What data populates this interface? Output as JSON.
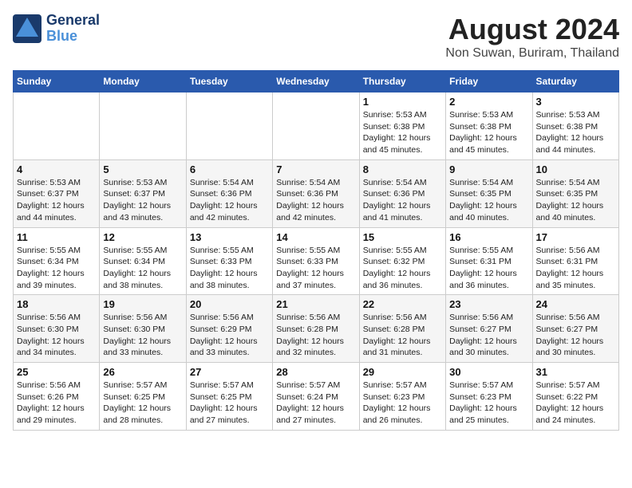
{
  "header": {
    "logo_general": "General",
    "logo_blue": "Blue",
    "month": "August 2024",
    "location": "Non Suwan, Buriram, Thailand"
  },
  "weekdays": [
    "Sunday",
    "Monday",
    "Tuesday",
    "Wednesday",
    "Thursday",
    "Friday",
    "Saturday"
  ],
  "rows": [
    [
      {
        "day": "",
        "info": ""
      },
      {
        "day": "",
        "info": ""
      },
      {
        "day": "",
        "info": ""
      },
      {
        "day": "",
        "info": ""
      },
      {
        "day": "1",
        "info": "Sunrise: 5:53 AM\nSunset: 6:38 PM\nDaylight: 12 hours\nand 45 minutes."
      },
      {
        "day": "2",
        "info": "Sunrise: 5:53 AM\nSunset: 6:38 PM\nDaylight: 12 hours\nand 45 minutes."
      },
      {
        "day": "3",
        "info": "Sunrise: 5:53 AM\nSunset: 6:38 PM\nDaylight: 12 hours\nand 44 minutes."
      }
    ],
    [
      {
        "day": "4",
        "info": "Sunrise: 5:53 AM\nSunset: 6:37 PM\nDaylight: 12 hours\nand 44 minutes."
      },
      {
        "day": "5",
        "info": "Sunrise: 5:53 AM\nSunset: 6:37 PM\nDaylight: 12 hours\nand 43 minutes."
      },
      {
        "day": "6",
        "info": "Sunrise: 5:54 AM\nSunset: 6:36 PM\nDaylight: 12 hours\nand 42 minutes."
      },
      {
        "day": "7",
        "info": "Sunrise: 5:54 AM\nSunset: 6:36 PM\nDaylight: 12 hours\nand 42 minutes."
      },
      {
        "day": "8",
        "info": "Sunrise: 5:54 AM\nSunset: 6:36 PM\nDaylight: 12 hours\nand 41 minutes."
      },
      {
        "day": "9",
        "info": "Sunrise: 5:54 AM\nSunset: 6:35 PM\nDaylight: 12 hours\nand 40 minutes."
      },
      {
        "day": "10",
        "info": "Sunrise: 5:54 AM\nSunset: 6:35 PM\nDaylight: 12 hours\nand 40 minutes."
      }
    ],
    [
      {
        "day": "11",
        "info": "Sunrise: 5:55 AM\nSunset: 6:34 PM\nDaylight: 12 hours\nand 39 minutes."
      },
      {
        "day": "12",
        "info": "Sunrise: 5:55 AM\nSunset: 6:34 PM\nDaylight: 12 hours\nand 38 minutes."
      },
      {
        "day": "13",
        "info": "Sunrise: 5:55 AM\nSunset: 6:33 PM\nDaylight: 12 hours\nand 38 minutes."
      },
      {
        "day": "14",
        "info": "Sunrise: 5:55 AM\nSunset: 6:33 PM\nDaylight: 12 hours\nand 37 minutes."
      },
      {
        "day": "15",
        "info": "Sunrise: 5:55 AM\nSunset: 6:32 PM\nDaylight: 12 hours\nand 36 minutes."
      },
      {
        "day": "16",
        "info": "Sunrise: 5:55 AM\nSunset: 6:31 PM\nDaylight: 12 hours\nand 36 minutes."
      },
      {
        "day": "17",
        "info": "Sunrise: 5:56 AM\nSunset: 6:31 PM\nDaylight: 12 hours\nand 35 minutes."
      }
    ],
    [
      {
        "day": "18",
        "info": "Sunrise: 5:56 AM\nSunset: 6:30 PM\nDaylight: 12 hours\nand 34 minutes."
      },
      {
        "day": "19",
        "info": "Sunrise: 5:56 AM\nSunset: 6:30 PM\nDaylight: 12 hours\nand 33 minutes."
      },
      {
        "day": "20",
        "info": "Sunrise: 5:56 AM\nSunset: 6:29 PM\nDaylight: 12 hours\nand 33 minutes."
      },
      {
        "day": "21",
        "info": "Sunrise: 5:56 AM\nSunset: 6:28 PM\nDaylight: 12 hours\nand 32 minutes."
      },
      {
        "day": "22",
        "info": "Sunrise: 5:56 AM\nSunset: 6:28 PM\nDaylight: 12 hours\nand 31 minutes."
      },
      {
        "day": "23",
        "info": "Sunrise: 5:56 AM\nSunset: 6:27 PM\nDaylight: 12 hours\nand 30 minutes."
      },
      {
        "day": "24",
        "info": "Sunrise: 5:56 AM\nSunset: 6:27 PM\nDaylight: 12 hours\nand 30 minutes."
      }
    ],
    [
      {
        "day": "25",
        "info": "Sunrise: 5:56 AM\nSunset: 6:26 PM\nDaylight: 12 hours\nand 29 minutes."
      },
      {
        "day": "26",
        "info": "Sunrise: 5:57 AM\nSunset: 6:25 PM\nDaylight: 12 hours\nand 28 minutes."
      },
      {
        "day": "27",
        "info": "Sunrise: 5:57 AM\nSunset: 6:25 PM\nDaylight: 12 hours\nand 27 minutes."
      },
      {
        "day": "28",
        "info": "Sunrise: 5:57 AM\nSunset: 6:24 PM\nDaylight: 12 hours\nand 27 minutes."
      },
      {
        "day": "29",
        "info": "Sunrise: 5:57 AM\nSunset: 6:23 PM\nDaylight: 12 hours\nand 26 minutes."
      },
      {
        "day": "30",
        "info": "Sunrise: 5:57 AM\nSunset: 6:23 PM\nDaylight: 12 hours\nand 25 minutes."
      },
      {
        "day": "31",
        "info": "Sunrise: 5:57 AM\nSunset: 6:22 PM\nDaylight: 12 hours\nand 24 minutes."
      }
    ]
  ]
}
